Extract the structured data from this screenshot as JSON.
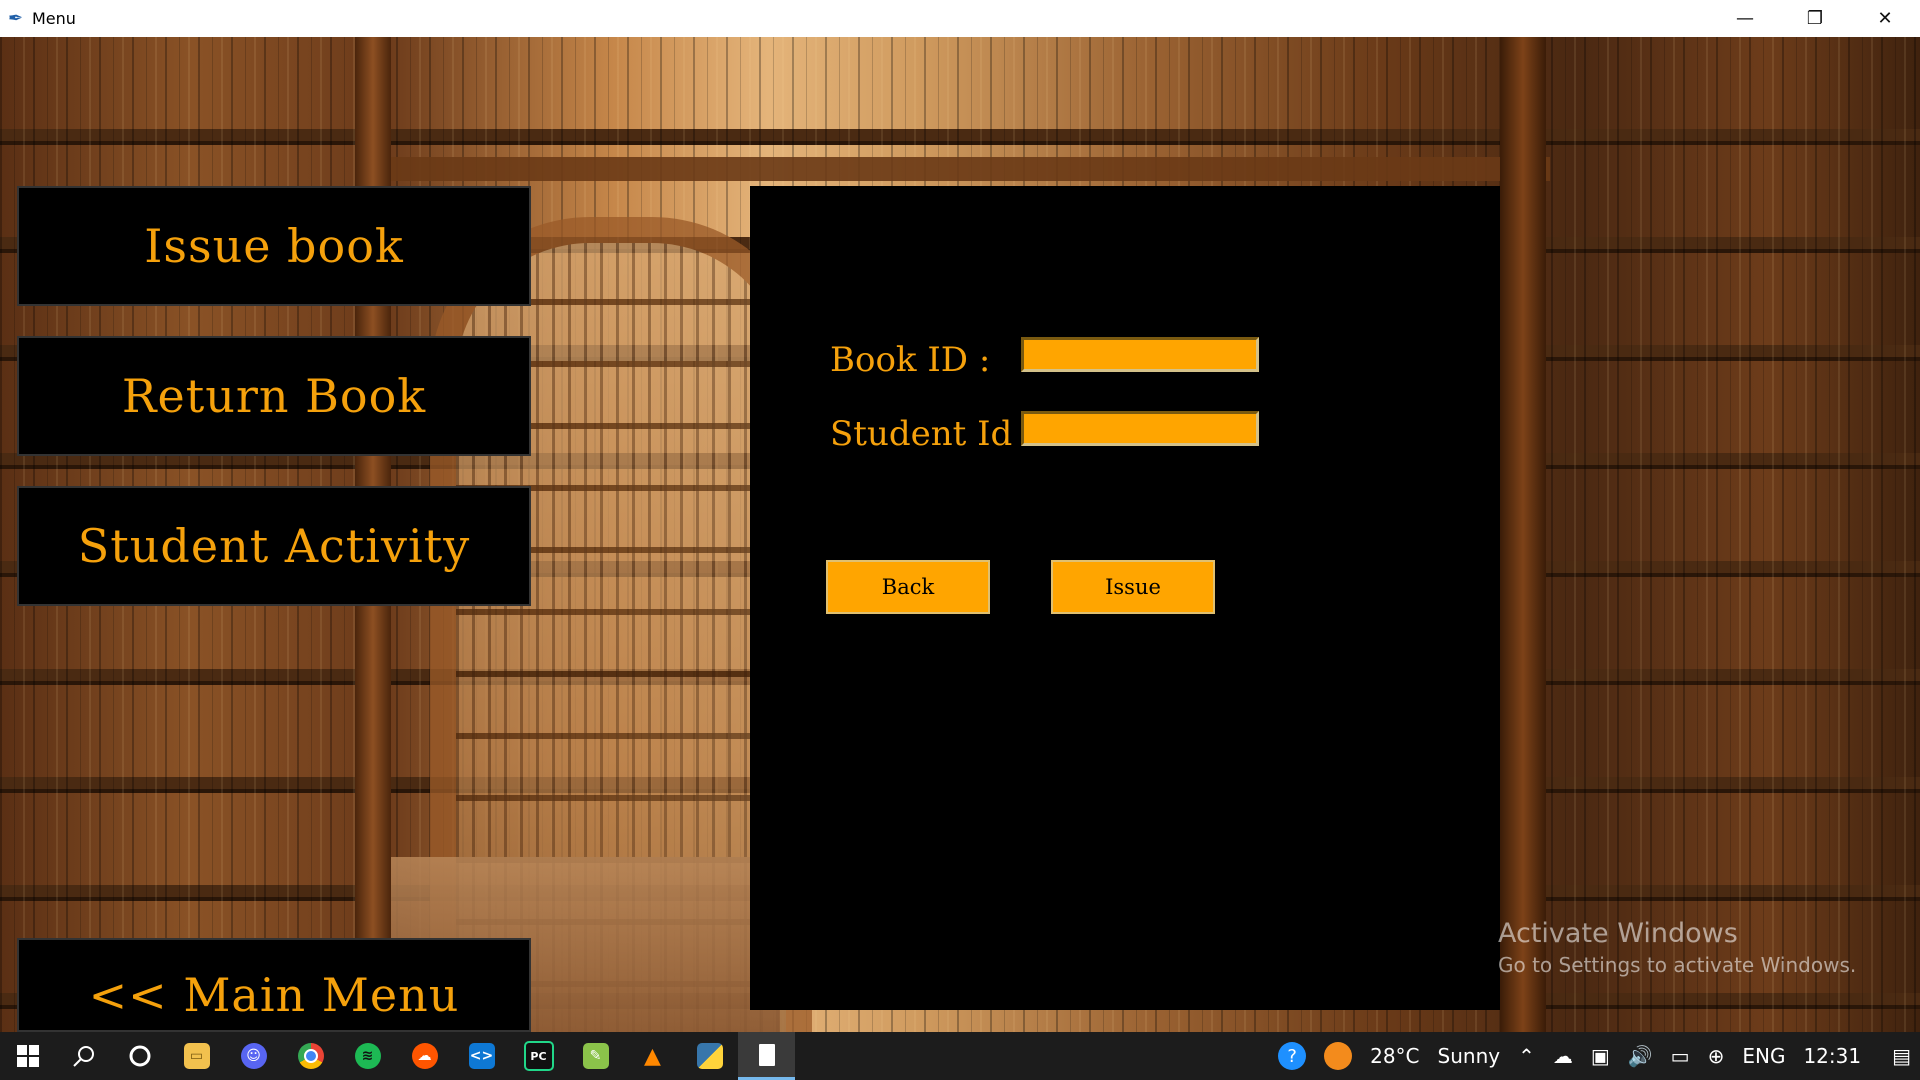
{
  "window": {
    "title": "Menu",
    "minimize": "—",
    "restore": "❐",
    "close": "✕"
  },
  "menu": {
    "issue_book": "Issue book",
    "return_book": "Return Book",
    "student_activity": "Student Activity",
    "main_menu": "<< Main Menu"
  },
  "form": {
    "book_id_label": "Book ID :",
    "student_id_label": "Student Id :",
    "book_id_value": "",
    "student_id_value": "",
    "back_label": "Back",
    "issue_label": "Issue"
  },
  "watermark": {
    "line1": "Activate Windows",
    "line2": "Go to Settings to activate Windows."
  },
  "taskbar": {
    "apps": [
      "start-icon",
      "search-icon",
      "cortana-icon",
      "file-explorer-icon",
      "discord-icon",
      "chrome-icon",
      "spotify-icon",
      "soundcloud-icon",
      "vscode-icon",
      "pycharm-icon",
      "notepadpp-icon",
      "vlc-icon",
      "python-idle-icon",
      "document-icon"
    ],
    "weather_temp": "28°C",
    "weather_text": "Sunny",
    "language": "ENG",
    "time": "12:31"
  },
  "colors": {
    "accent": "#ffa500",
    "panel": "#000000",
    "text_accent": "#f5a10c"
  }
}
